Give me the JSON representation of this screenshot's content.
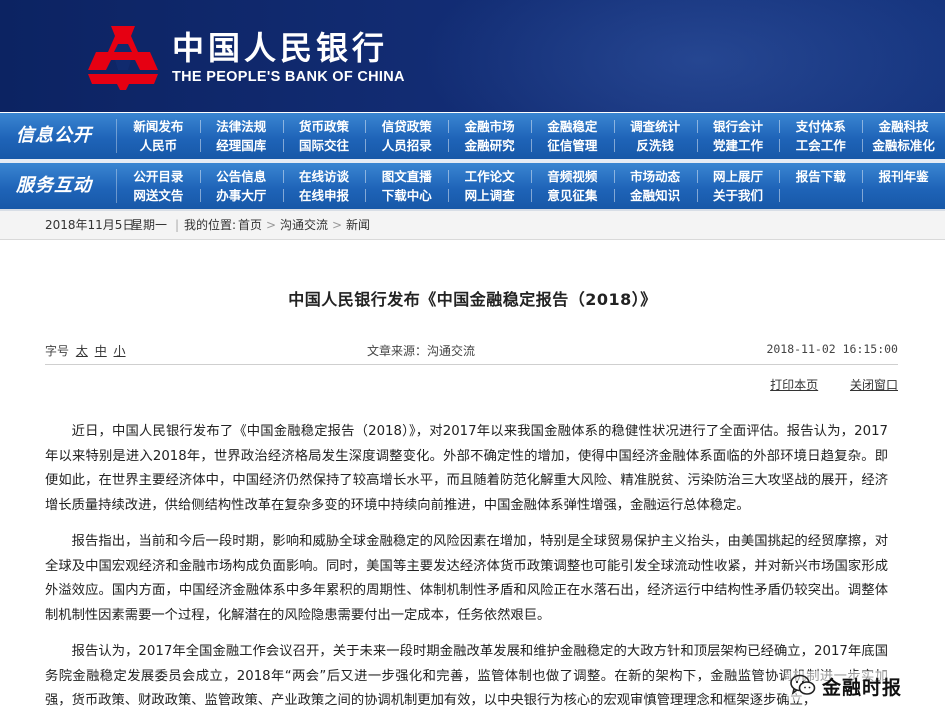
{
  "brand": {
    "name_cn": "中国人民银行",
    "name_en": "THE PEOPLE'S BANK OF CHINA",
    "accent": "#e60012",
    "navy": "#102a6e"
  },
  "nav_info": {
    "title": "信息公开",
    "row1": [
      "新闻发布",
      "法律法规",
      "货币政策",
      "信贷政策",
      "金融市场",
      "金融稳定",
      "调查统计",
      "银行会计",
      "支付体系",
      "金融科技"
    ],
    "row2": [
      "人民币",
      "经理国库",
      "国际交往",
      "人员招录",
      "金融研究",
      "征信管理",
      "反洗钱",
      "党建工作",
      "工会工作",
      "金融标准化"
    ]
  },
  "nav_service": {
    "title": "服务互动",
    "row1": [
      "公开目录",
      "公告信息",
      "在线访谈",
      "图文直播",
      "工作论文",
      "音频视频",
      "市场动态",
      "网上展厅",
      "报告下载",
      "报刊年鉴"
    ],
    "row2": [
      "网送文告",
      "办事大厅",
      "在线申报",
      "下载中心",
      "网上调查",
      "意见征集",
      "金融知识",
      "关于我们",
      "",
      ""
    ]
  },
  "breadcrumb": {
    "date": "2018年11月5日",
    "weekday": "星期一",
    "location_label": "我的位置:",
    "home": "首页",
    "section": "沟通交流",
    "current": "新闻",
    "separator": ">"
  },
  "article": {
    "title": "中国人民银行发布《中国金融稳定报告（2018）》",
    "font_size_label": "字号",
    "font_sizes": [
      "太",
      "中",
      "小"
    ],
    "source": "文章来源：沟通交流",
    "date": "2018-11-02 16:15:00",
    "print_label": "打印本页",
    "close_label": "关闭窗口",
    "paragraphs": [
      "近日，中国人民银行发布了《中国金融稳定报告（2018）》，对2017年以来我国金融体系的稳健性状况进行了全面评估。报告认为，2017年以来特别是进入2018年，世界政治经济格局发生深度调整变化。外部不确定性的增加，使得中国经济金融体系面临的外部环境日趋复杂。即便如此，在世界主要经济体中，中国经济仍然保持了较高增长水平，而且随着防范化解重大风险、精准脱贫、污染防治三大攻坚战的展开，经济增长质量持续改进，供给侧结构性改革在复杂多变的环境中持续向前推进，中国金融体系弹性增强，金融运行总体稳定。",
      "报告指出，当前和今后一段时期，影响和威胁全球金融稳定的风险因素在增加，特别是全球贸易保护主义抬头，由美国挑起的经贸摩擦，对全球及中国宏观经济和金融市场构成负面影响。同时，美国等主要发达经济体货币政策调整也可能引发全球流动性收紧，并对新兴市场国家形成外溢效应。国内方面，中国经济金融体系中多年累积的周期性、体制机制性矛盾和风险正在水落石出，经济运行中结构性矛盾仍较突出。调整体制机制性因素需要一个过程，化解潜在的风险隐患需要付出一定成本，任务依然艰巨。",
      "报告认为，2017年全国金融工作会议召开，关于未来一段时期金融改革发展和维护金融稳定的大政方针和顶层架构已经确立，2017年底国务院金融稳定发展委员会成立，2018年“两会”后又进一步强化和完善，监管体制也做了调整。在新的架构下，金融监管协调机制进一步实加强，货币政策、财政政策、监管政策、产业政策之间的协调机制更加有效，以中央银行为核心的宏观审慎管理理念和框架逐步确立，"
    ]
  },
  "watermark": {
    "text": "金融时报",
    "icon": "wechat-icon"
  }
}
